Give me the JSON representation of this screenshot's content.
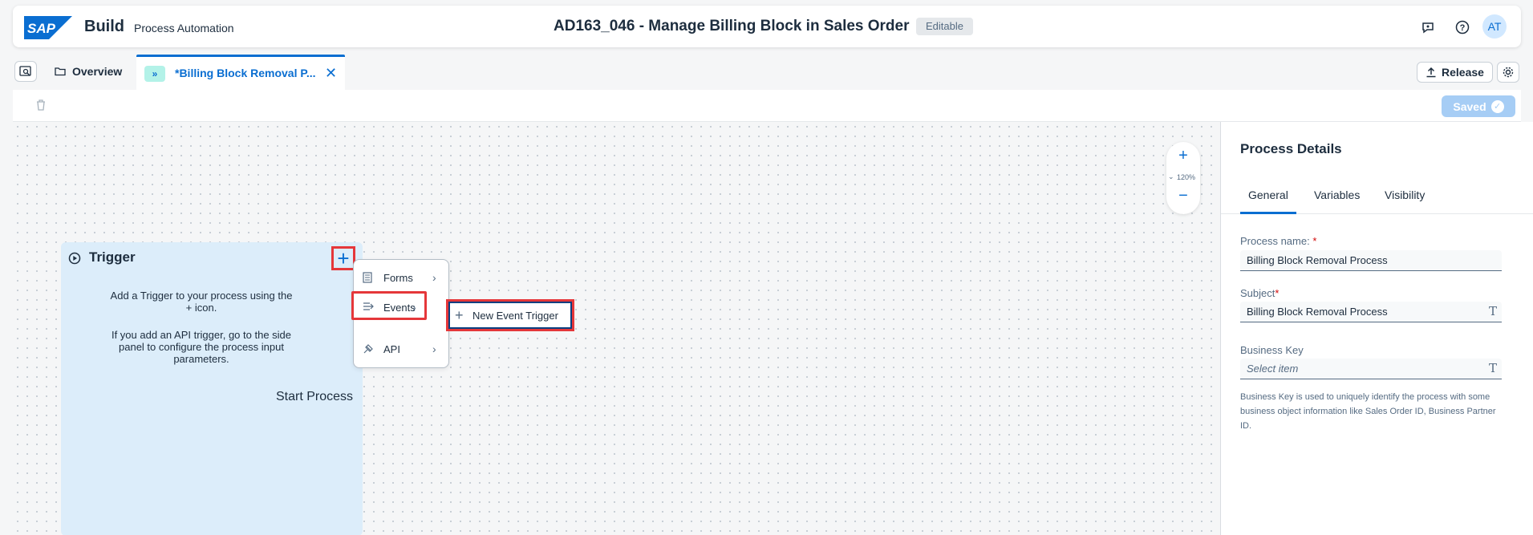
{
  "shell": {
    "logo_text": "SAP",
    "product": "Build",
    "subtitle": "Process Automation",
    "title": "AD163_046 - Manage Billing Block in Sales Order",
    "status_badge": "Editable",
    "avatar_initials": "AT"
  },
  "tabs": {
    "overview_label": "Overview",
    "active_label": "*Billing Block Removal P...",
    "active_icon": "»",
    "release_label": "Release"
  },
  "toolbar": {
    "saved_label": "Saved"
  },
  "canvas": {
    "zoom_level": "120%",
    "trigger": {
      "title": "Trigger",
      "desc1": "Add a Trigger to your process using the + icon.",
      "desc2": "If you add an API trigger, go to the side panel to configure the process input parameters.",
      "start_label": "Start Process"
    },
    "menu": [
      {
        "label": "Forms",
        "icon": "form-icon"
      },
      {
        "label": "Events",
        "icon": "events-icon"
      },
      {
        "label": "API",
        "icon": "api-icon"
      }
    ],
    "submenu_label": "New Event Trigger"
  },
  "panel": {
    "title": "Process Details",
    "tabs": [
      "General",
      "Variables",
      "Visibility"
    ],
    "process_name_label": "Process name:",
    "process_name_value": "Billing Block Removal Process",
    "subject_label": "Subject",
    "subject_value": "Billing Block Removal Process",
    "business_key_label": "Business Key",
    "business_key_placeholder": "Select item",
    "business_key_help": "Business Key is used to uniquely identify the process with some business object information like Sales Order ID, Business Partner ID."
  },
  "colors": {
    "accent": "#0a6ed1",
    "highlight": "#e5373a",
    "trigger_bg": "#dcedfa"
  }
}
